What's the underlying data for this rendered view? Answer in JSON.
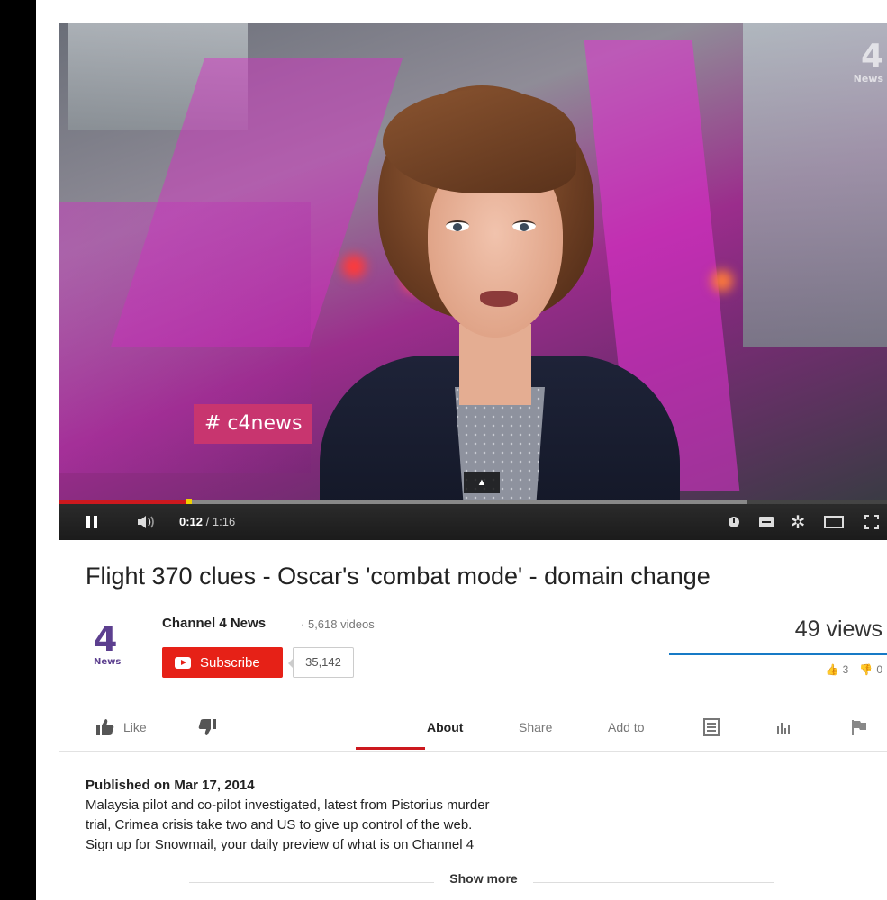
{
  "player": {
    "overlay_tag": "# c4news",
    "logo_number": "4",
    "logo_word": "News",
    "current_time": "0:12",
    "duration": "1:16",
    "played_fraction": 0.158,
    "buffered_fraction": 0.83,
    "icons": [
      "pause-icon",
      "volume-icon",
      "annotations-icon",
      "captions-icon",
      "settings-icon",
      "theater-icon",
      "fullscreen-icon"
    ]
  },
  "video": {
    "title": "Flight 370 clues - Oscar's 'combat mode' - domain change",
    "views": "49 views",
    "likes": "3",
    "dislikes": "0"
  },
  "channel": {
    "name": "Channel 4 News",
    "separator": "·",
    "video_count": "5,618 videos",
    "logo_number": "4",
    "logo_word": "News",
    "subscribe_label": "Subscribe",
    "subscriber_count": "35,142"
  },
  "actions": {
    "like_label": "Like",
    "tabs": [
      "About",
      "Share",
      "Add to"
    ],
    "active_tab": "About"
  },
  "description": {
    "published": "Published on Mar 17, 2014",
    "lines": [
      "Malaysia pilot and co-pilot investigated, latest from Pistorius murder",
      "trial, Crimea crisis take two and US to give up control of the web.",
      "Sign up for Snowmail, your daily preview of what is on Channel 4"
    ],
    "show_more": "Show more"
  },
  "colors": {
    "accent_red": "#cc181e",
    "subscribe_red": "#e62117",
    "sentiment_blue": "#167ac6",
    "tag_pink": "#c8356f"
  }
}
